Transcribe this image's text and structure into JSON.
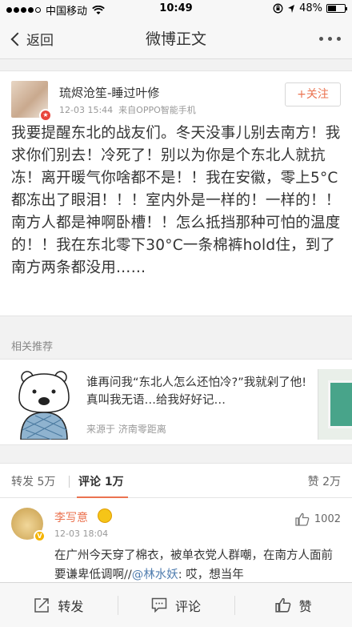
{
  "status_bar": {
    "carrier": "中国移动",
    "time": "10:49",
    "battery": "48%",
    "battery_level": 0.48
  },
  "nav": {
    "back_label": "返回",
    "title": "微博正文"
  },
  "post": {
    "username": "琉烬沧笙-睡过叶修",
    "date": "12-03 15:44",
    "source": "来自OPPO智能手机",
    "follow_label": "+关注",
    "content": "我要提醒东北的战友们。冬天没事儿别去南方！我求你们别去！冷死了！别以为你是个东北人就抗冻！离开暖气你啥都不是！！我在安徽，零上5°C都冻出了眼泪！！！室内外是一样的！一样的！！南方人都是神啊卧槽！！怎么抵挡那种可怕的温度的！！我在东北零下30°C一条棉裤hold住，到了南方两条都没用……"
  },
  "related": {
    "header": "相关推荐",
    "text": "谁再问我“东北人怎么还怕冷?”我就剁了他! 真叫我无语…给我好好记…",
    "source": "来源于 济南零距离"
  },
  "tabs": {
    "repost": "转发 5万",
    "comment": "评论 1万",
    "like": "赞 2万"
  },
  "comment": {
    "name": "李写意",
    "time": "12-03 18:04",
    "likes": "1002",
    "text_before": "在广州今天穿了棉衣，被单衣党人群嘲，在南方人面前要谦卑低调啊//",
    "mention": "@林水妖",
    "text_after": ": 哎，想当年"
  },
  "bottom_bar": {
    "repost": "转发",
    "comment": "评论",
    "like": "赞"
  }
}
